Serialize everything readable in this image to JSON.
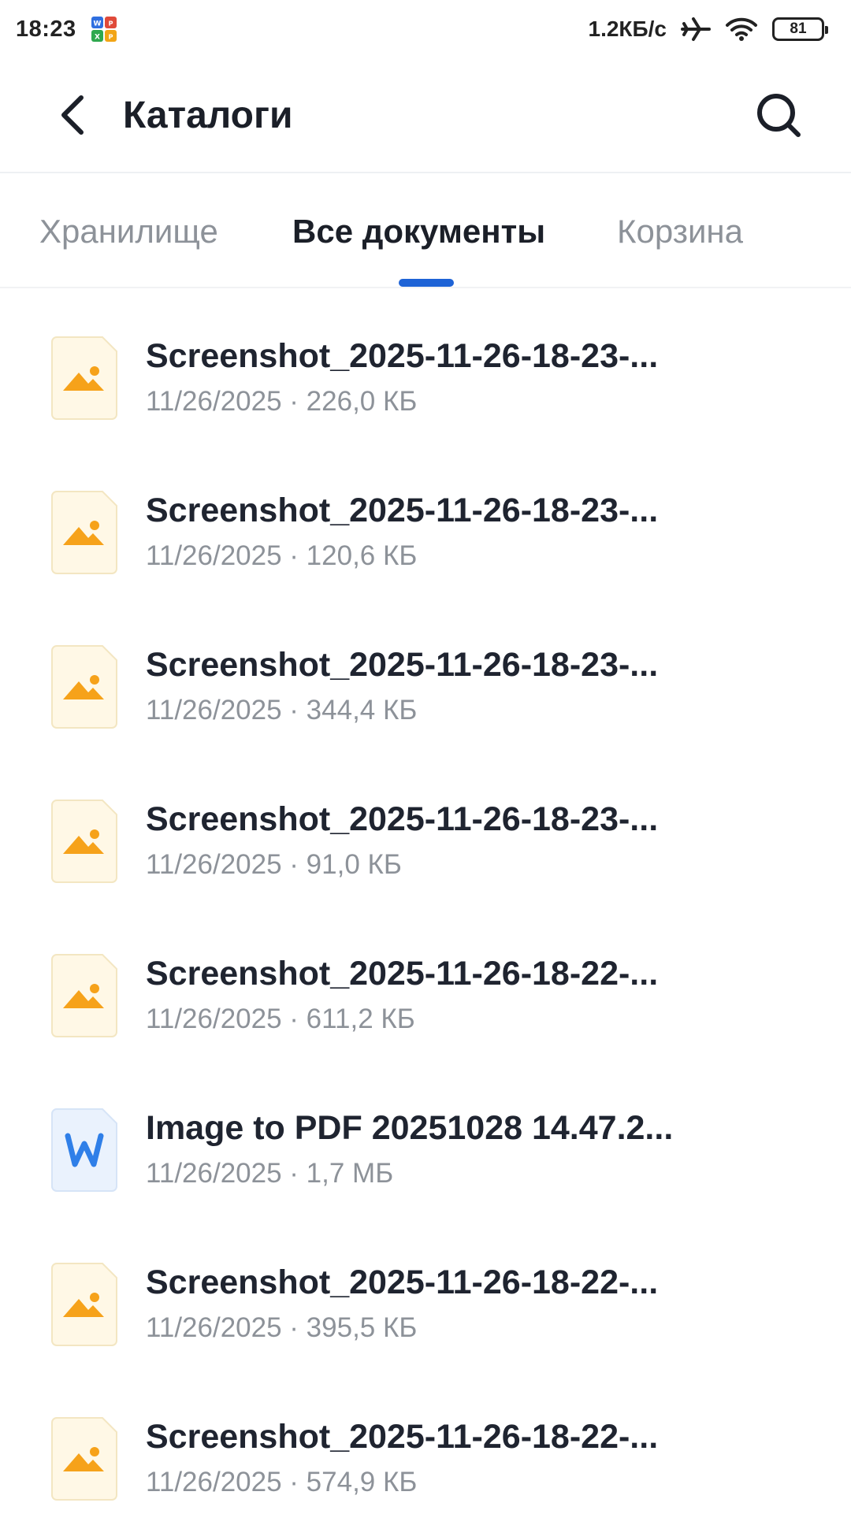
{
  "status_bar": {
    "time": "18:23",
    "net_speed": "1.2КБ/с",
    "battery": "81",
    "icons": [
      "office-app-icon",
      "airplane-icon",
      "wifi-icon",
      "battery-icon"
    ]
  },
  "header": {
    "title": "Каталоги",
    "back_icon": "chevron-left-icon",
    "search_icon": "search-icon"
  },
  "tabs": [
    {
      "label": "Хранилище",
      "active": false
    },
    {
      "label": "Все документы",
      "active": true
    },
    {
      "label": "Корзина",
      "active": false
    }
  ],
  "accent_color": "#1e63d6",
  "files": [
    {
      "name": "Screenshot_2025-11-26-18-23-...",
      "meta": "11/26/2025 · 226,0 КБ",
      "type": "image"
    },
    {
      "name": "Screenshot_2025-11-26-18-23-...",
      "meta": "11/26/2025 · 120,6 КБ",
      "type": "image"
    },
    {
      "name": "Screenshot_2025-11-26-18-23-...",
      "meta": "11/26/2025 · 344,4 КБ",
      "type": "image"
    },
    {
      "name": "Screenshot_2025-11-26-18-23-...",
      "meta": "11/26/2025 · 91,0 КБ",
      "type": "image"
    },
    {
      "name": "Screenshot_2025-11-26-18-22-...",
      "meta": "11/26/2025 · 611,2 КБ",
      "type": "image"
    },
    {
      "name": "Image to PDF 20251028 14.47.2...",
      "meta": "11/26/2025 · 1,7 МБ",
      "type": "word"
    },
    {
      "name": "Screenshot_2025-11-26-18-22-...",
      "meta": "11/26/2025 · 395,5 КБ",
      "type": "image"
    },
    {
      "name": "Screenshot_2025-11-26-18-22-...",
      "meta": "11/26/2025 · 574,9 КБ",
      "type": "image"
    }
  ]
}
